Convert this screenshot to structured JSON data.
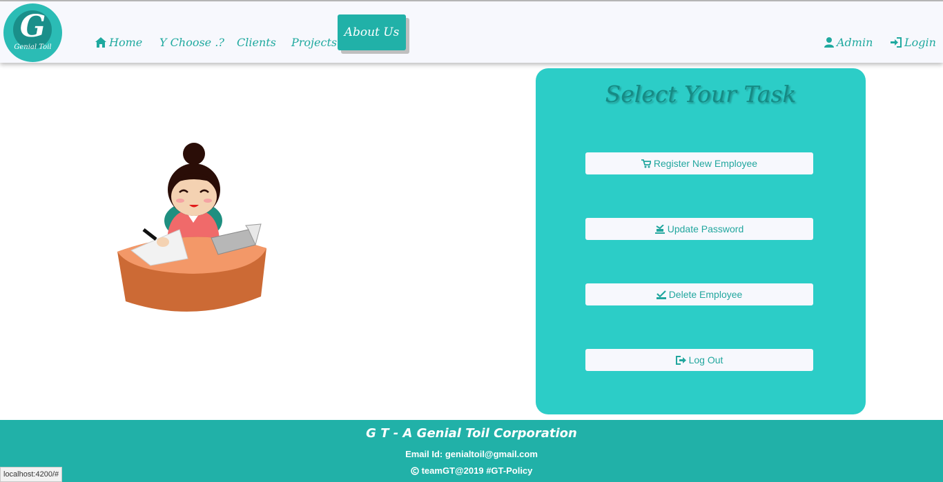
{
  "logo": {
    "letter": "G",
    "word": "Genial Toil"
  },
  "nav": {
    "home": "Home",
    "why": "Y Choose .?",
    "clients": "Clients",
    "projects": "Projects",
    "about": "About Us",
    "admin": "Admin",
    "login": "Login"
  },
  "panel": {
    "title": "Select Your Task",
    "buttons": [
      {
        "label": "Register New Employee",
        "icon": "cart-icon"
      },
      {
        "label": "Update Password",
        "icon": "stamp-icon"
      },
      {
        "label": "Delete Employee",
        "icon": "check-stamp-icon"
      },
      {
        "label": "Log Out",
        "icon": "logout-icon"
      }
    ]
  },
  "footer": {
    "title": "G T - A Genial Toil Corporation",
    "email": "Email Id: genialtoil@gmail.com",
    "copyright": "teamGT@2019 #GT-Policy"
  },
  "status_url": "localhost:4200/#",
  "colors": {
    "teal": "#2ccdc7",
    "dark_teal": "#21b1a8",
    "nav_bg": "#f7f8fd"
  }
}
